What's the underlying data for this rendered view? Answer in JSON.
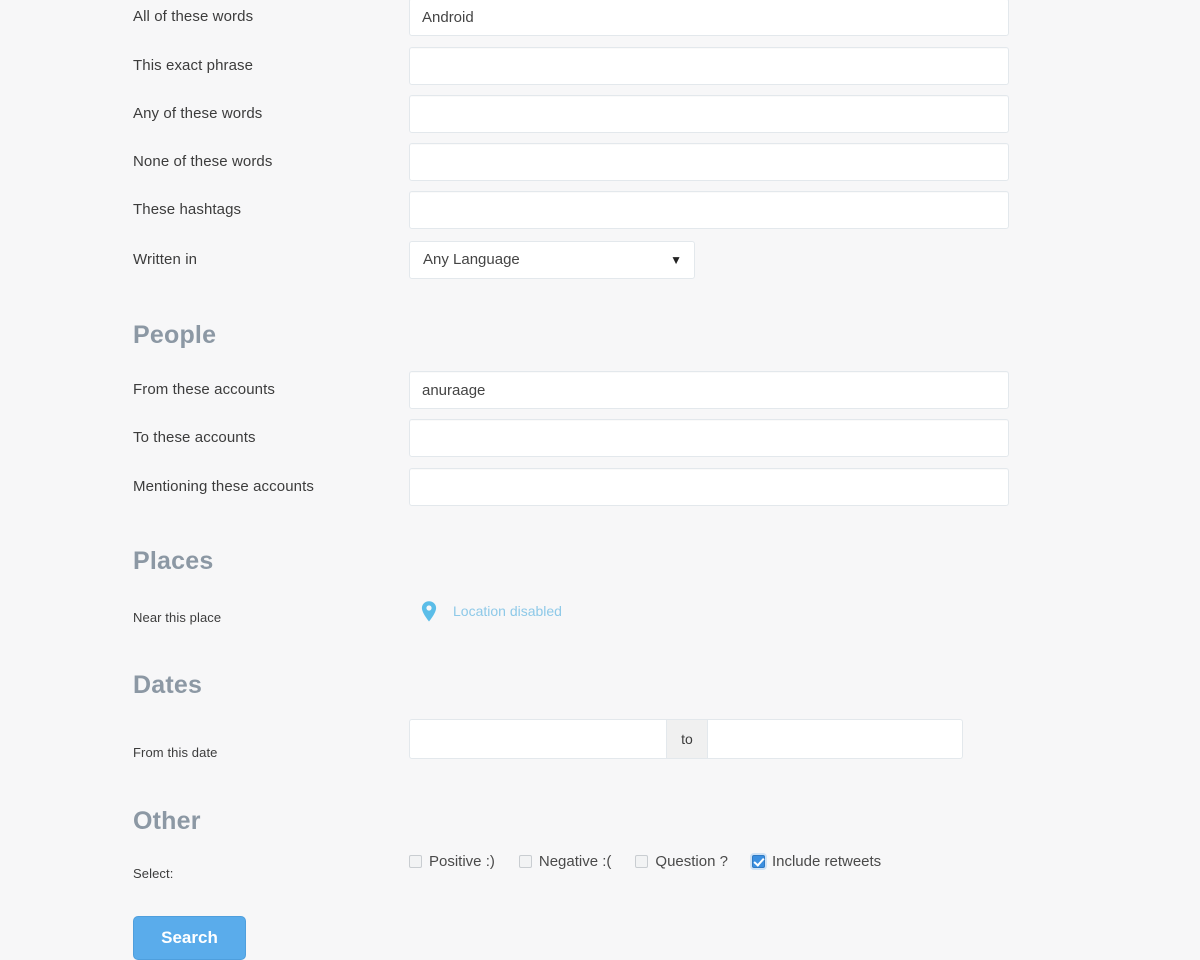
{
  "form": {
    "words_section": {
      "rows": [
        {
          "label": "All of these words",
          "value": "Android",
          "placeholder": ""
        },
        {
          "label": "This exact phrase",
          "value": "",
          "placeholder": ""
        },
        {
          "label": "Any of these words",
          "value": "",
          "placeholder": ""
        },
        {
          "label": "None of these words",
          "value": "",
          "placeholder": ""
        },
        {
          "label": "These hashtags",
          "value": "",
          "placeholder": ""
        }
      ],
      "language": {
        "label": "Written in",
        "selected": "Any Language",
        "arrow_icon": "chevron-down-icon"
      }
    },
    "people_section": {
      "heading": "People",
      "rows": [
        {
          "label": "From these accounts",
          "value": "anuraage",
          "placeholder": ""
        },
        {
          "label": "To these accounts",
          "value": "",
          "placeholder": ""
        },
        {
          "label": "Mentioning these accounts",
          "value": "",
          "placeholder": ""
        }
      ]
    },
    "places_section": {
      "heading": "Places",
      "label": "Near this place",
      "location_icon": "map-pin-icon",
      "location_status": "Location disabled"
    },
    "dates_section": {
      "heading": "Dates",
      "label": "From this date",
      "from_value": "",
      "from_placeholder": "",
      "separator": "to",
      "to_value": "",
      "to_placeholder": ""
    },
    "other_section": {
      "heading": "Other",
      "label": "Select:",
      "checkboxes": [
        {
          "label": "Positive :)",
          "checked": false
        },
        {
          "label": "Negative :(",
          "checked": false
        },
        {
          "label": "Question ?",
          "checked": false
        },
        {
          "label": "Include retweets",
          "checked": true
        }
      ]
    },
    "submit": {
      "label": "Search"
    }
  },
  "colors": {
    "page_background": "#f7f7f8",
    "heading": "#8c98a4",
    "label": "#3c3c3c",
    "input_border": "#e3e8ec",
    "accent_blue": "#5aaceb",
    "link_blue": "#8ec9e8",
    "checkbox_checked": "#3b8fe0"
  }
}
